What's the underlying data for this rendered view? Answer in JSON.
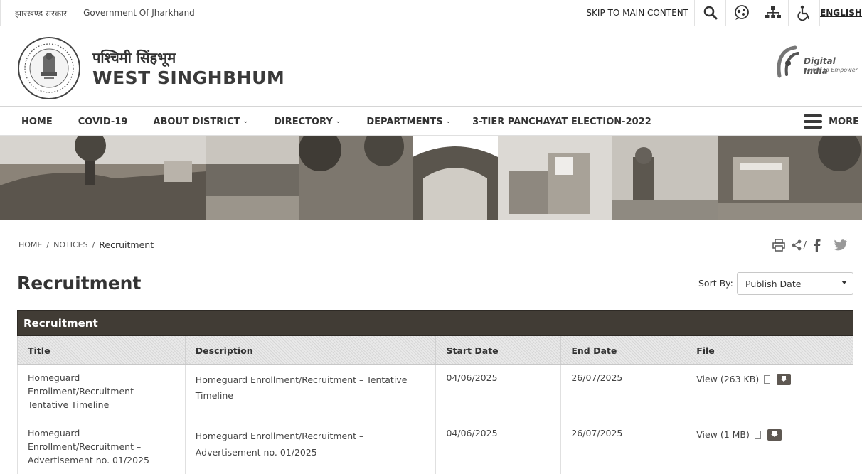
{
  "topbar": {
    "govt_hindi": "झारखण्ड सरकार",
    "govt_english": "Government Of Jharkhand",
    "skip_label": "SKIP TO MAIN CONTENT",
    "language": "ENGLISH"
  },
  "header": {
    "title_hindi": "पश्चिमी सिंहभूम",
    "title_english": "WEST SINGHBHUM",
    "partner_name": "Digital India",
    "partner_tagline": "Power To Empower"
  },
  "nav": {
    "items": [
      {
        "label": "HOME"
      },
      {
        "label": "COVID-19"
      },
      {
        "label": "ABOUT DISTRICT"
      },
      {
        "label": "DIRECTORY"
      },
      {
        "label": "DEPARTMENTS"
      },
      {
        "label": "3-TIER PANCHAYAT ELECTION-2022"
      }
    ],
    "more_label": "MORE"
  },
  "breadcrumb": {
    "home": "HOME",
    "notices": "NOTICES",
    "current": "Recruitment"
  },
  "page": {
    "title": "Recruitment",
    "sort_label": "Sort By:",
    "sort_value": "Publish Date"
  },
  "table": {
    "caption": "Recruitment",
    "headers": [
      "Title",
      "Description",
      "Start Date",
      "End Date",
      "File"
    ],
    "rows": [
      {
        "title": "Homeguard Enrollment/Recruitment – Tentative Timeline",
        "description": "Homeguard Enrollment/Recruitment – Tentative Timeline",
        "start": "04/06/2025",
        "end": "26/07/2025",
        "file": "View (263 KB)"
      },
      {
        "title": "Homeguard Enrollment/Recruitment – Advertisement no. 01/2025",
        "description": "Homeguard Enrollment/Recruitment – Advertisement no. 01/2025",
        "start": "04/06/2025",
        "end": "26/07/2025",
        "file": "View (1 MB)"
      }
    ]
  },
  "colors": {
    "caption_bg": "#413c35",
    "text": "#333333"
  }
}
